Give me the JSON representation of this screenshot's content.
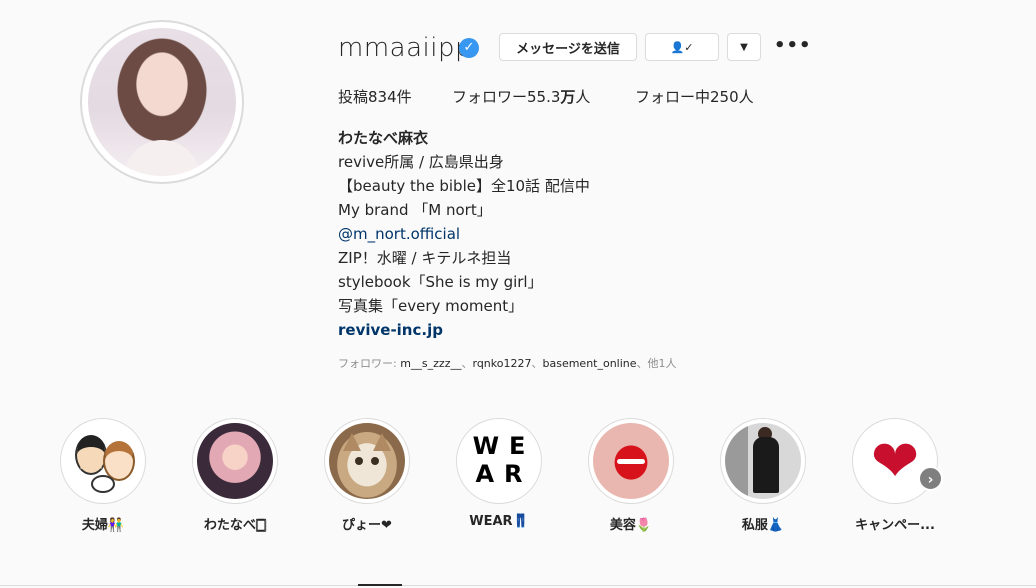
{
  "profile": {
    "username": "mmaaiipp",
    "verified_icon": "verified-badge-icon",
    "buttons": {
      "message": "メッセージを送信",
      "follow_icon": "person-check-icon",
      "dropdown_icon": "chevron-down-icon",
      "more": "•••"
    },
    "stats": {
      "posts": "投稿834件",
      "followers_prefix": "フォロワー55.3",
      "followers_unit": "万",
      "followers_suffix": "人",
      "following": "フォロー中250人"
    },
    "bio": {
      "name": "わたなべ麻衣",
      "lines": [
        "revive所属 / 広島県出身",
        "【beauty the bible】全10話 配信中",
        "My brand 「M nort」",
        "@m_nort.official",
        "ZIP！水曜 / キテルネ担当",
        "stylebook「She is my girl」",
        "写真集「every moment」"
      ],
      "link": "revive-inc.jp"
    },
    "followed_by": {
      "prefix": "フォロワー: ",
      "names": "m__s_zzz__",
      "sep1": "、",
      "name2": "rqnko1227",
      "sep2": "、",
      "name3": "basement_online",
      "suffix": "、他1人"
    }
  },
  "highlights": [
    {
      "label": "夫婦👫"
    },
    {
      "label": "わたなべ🀆"
    },
    {
      "label": "ぴょー❤"
    },
    {
      "label": "WEAR👖"
    },
    {
      "label": "美容🌷"
    },
    {
      "label": "私服👗"
    },
    {
      "label": "キャンペー..."
    }
  ],
  "highlight_wear_text": [
    "WE",
    "AR"
  ],
  "highlights_next_icon": "chevron-right-icon",
  "colors": {
    "link": "#003569",
    "verified": "#3897f0",
    "background": "#fafafa"
  }
}
